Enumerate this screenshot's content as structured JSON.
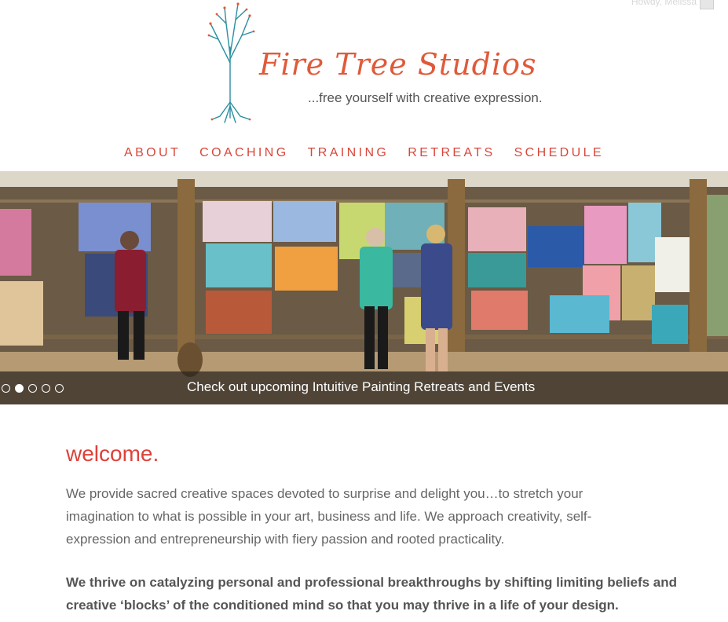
{
  "admin_bar": {
    "greeting": "Howdy, Melissa",
    "avatar_icon": "user-avatar-icon"
  },
  "header": {
    "logo_icon": "fire-tree-logo-icon",
    "site_title": "Fire Tree Studios",
    "tagline": "...free yourself with creative expression."
  },
  "nav": {
    "items": [
      {
        "label": "ABOUT"
      },
      {
        "label": "COACHING"
      },
      {
        "label": "TRAINING"
      },
      {
        "label": "RETREATS"
      },
      {
        "label": "SCHEDULE"
      }
    ]
  },
  "slider": {
    "caption": "Check out upcoming Intuitive Painting Retreats and Events",
    "slide_count": 5,
    "active_slide": 2
  },
  "content": {
    "heading": "welcome.",
    "intro": "We provide sacred creative spaces devoted to surprise and delight you…to stretch your imagination to what is possible in your art, business and life. We approach creativity, self-expression and entrepreneurship with fiery passion and rooted practicality.",
    "emphasis": "We thrive on catalyzing personal and professional breakthroughs by shifting limiting beliefs and creative ‘blocks’ of the conditioned mind so that you may thrive in a life of your design."
  },
  "colors": {
    "accent": "#d9463a",
    "heading": "#e0403a",
    "logo": "#e05a3a",
    "tree": "#2a8fa0",
    "body_text": "#666666"
  }
}
